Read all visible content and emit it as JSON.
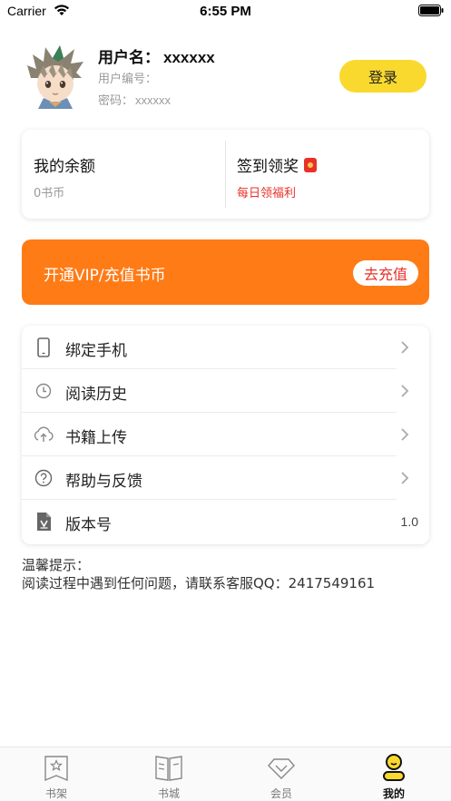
{
  "status_bar": {
    "carrier": "Carrier",
    "time": "6:55 PM"
  },
  "profile": {
    "username_label": "用户名：",
    "username_value": "xxxxxx",
    "userid_label": "用户编号：",
    "password_label": "密码：",
    "password_value": "xxxxxx",
    "login_label": "登录"
  },
  "balance_card": {
    "balance_title": "我的余额",
    "balance_value": "0书币",
    "signin_title": "签到领奖",
    "signin_sub": "每日领福利"
  },
  "vip_banner": {
    "text": "开通VIP/充值书币",
    "button_label": "去充值"
  },
  "menu": {
    "items": [
      {
        "label": "绑定手机",
        "icon": "phone-icon"
      },
      {
        "label": "阅读历史",
        "icon": "clock-icon"
      },
      {
        "label": "书籍上传",
        "icon": "cloud-upload-icon"
      },
      {
        "label": "帮助与反馈",
        "icon": "help-icon"
      },
      {
        "label": "版本号",
        "icon": "version-icon",
        "value": "1.0"
      }
    ]
  },
  "tips": {
    "title": "温馨提示：",
    "body": "阅读过程中遇到任何问题，请联系客服QQ：2417549161"
  },
  "tab_bar": {
    "tabs": [
      {
        "label": "书架",
        "icon": "bookshelf-icon"
      },
      {
        "label": "书城",
        "icon": "bookstore-icon"
      },
      {
        "label": "会员",
        "icon": "member-icon"
      },
      {
        "label": "我的",
        "icon": "profile-icon",
        "active": true
      }
    ]
  },
  "colors": {
    "accent_yellow": "#f9d92d",
    "vip_orange": "#ff7b16",
    "alert_red": "#e8312a"
  }
}
